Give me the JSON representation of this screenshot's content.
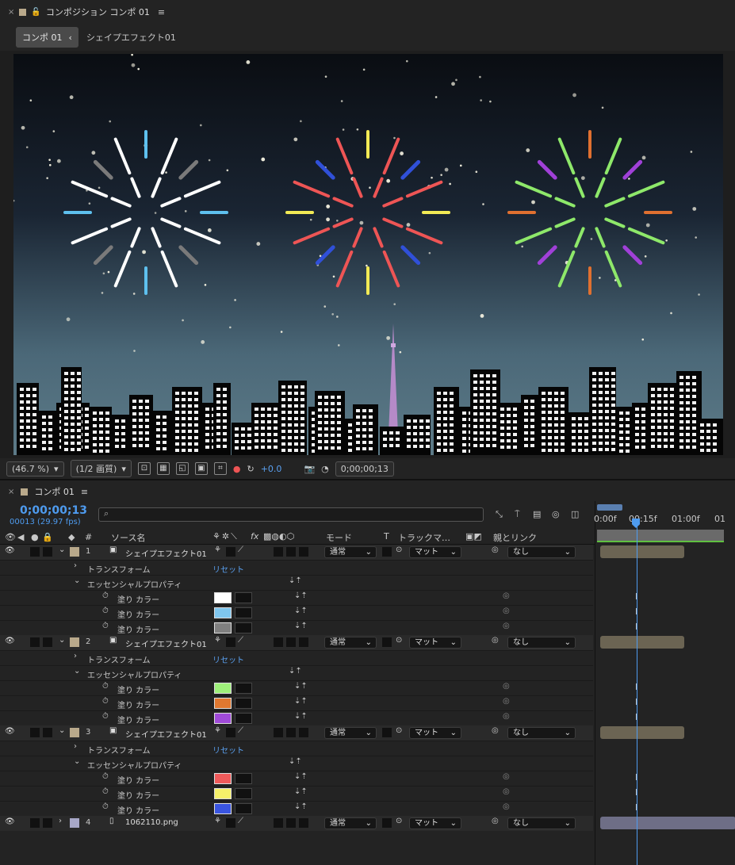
{
  "viewer": {
    "close": "×",
    "lock": "🔓",
    "title": "コンポジション コンポ 01",
    "menu": "≡"
  },
  "breadcrumb": {
    "active": "コンポ 01",
    "chevron": "‹",
    "next": "シェイプエフェクト01"
  },
  "controls": {
    "zoom": "(46.7 %)",
    "resolution": "(1/2 画質)",
    "exposure": "+0.0",
    "timecode": "0;00;00;13"
  },
  "timeline": {
    "close": "×",
    "title": "コンポ 01",
    "menu": "≡",
    "timecode": "0;00;00;13",
    "frames_fps": "00013 (29.97 fps)",
    "search_icon": "⌕"
  },
  "columns": {
    "num": "#",
    "source": "ソース名",
    "fx": "fx",
    "mode": "モード",
    "t": "T",
    "track": "トラックマ…",
    "parent": "親とリンク"
  },
  "ruler": {
    "t0": "0:00f",
    "t1": "00:15f",
    "t2": "01:00f",
    "t3": "01"
  },
  "rows": [
    {
      "kind": "layer",
      "num": "1",
      "name": "シェイプエフェクト01",
      "mode": "通常",
      "track": "マット",
      "parent": "なし"
    },
    {
      "kind": "group",
      "label": "トランスフォーム",
      "reset": "リセット"
    },
    {
      "kind": "group",
      "label": "エッセンシャルプロパティ"
    },
    {
      "kind": "prop",
      "label": "塗り カラー",
      "color": "#ffffff"
    },
    {
      "kind": "prop",
      "label": "塗り カラー",
      "color": "#7fc6ee"
    },
    {
      "kind": "prop",
      "label": "塗り カラー",
      "color": "#808080"
    },
    {
      "kind": "layer",
      "num": "2",
      "name": "シェイプエフェクト01",
      "mode": "通常",
      "track": "マット",
      "parent": "なし"
    },
    {
      "kind": "group",
      "label": "トランスフォーム",
      "reset": "リセット"
    },
    {
      "kind": "group",
      "label": "エッセンシャルプロパティ"
    },
    {
      "kind": "prop",
      "label": "塗り カラー",
      "color": "#9ef07a"
    },
    {
      "kind": "prop",
      "label": "塗り カラー",
      "color": "#e07830"
    },
    {
      "kind": "prop",
      "label": "塗り カラー",
      "color": "#a04ad8"
    },
    {
      "kind": "layer",
      "num": "3",
      "name": "シェイプエフェクト01",
      "mode": "通常",
      "track": "マット",
      "parent": "なし"
    },
    {
      "kind": "group",
      "label": "トランスフォーム",
      "reset": "リセット"
    },
    {
      "kind": "group",
      "label": "エッセンシャルプロパティ"
    },
    {
      "kind": "prop",
      "label": "塗り カラー",
      "color": "#ef5a5a"
    },
    {
      "kind": "prop",
      "label": "塗り カラー",
      "color": "#f5f06a"
    },
    {
      "kind": "prop",
      "label": "塗り カラー",
      "color": "#3a55e0"
    },
    {
      "kind": "layer",
      "num": "4",
      "name": "1062110.png",
      "mode": "通常",
      "track": "マット",
      "parent": "なし"
    }
  ],
  "fireworks": [
    {
      "long": "#ffffff",
      "short_v": "#5ec0ee",
      "short_h": "#5ec0ee",
      "diag": "#7a7a7a"
    },
    {
      "long": "#ee5555",
      "short_v": "#f2ea55",
      "short_h": "#f2ea55",
      "diag": "#3050d8"
    },
    {
      "long": "#8ee86a",
      "short_v": "#e07030",
      "short_h": "#e07030",
      "diag": "#a040d8"
    }
  ],
  "colors": {
    "accent": "#4e9bef",
    "layer_label": "#b9a98b",
    "png_label": "#a7a7c7"
  }
}
